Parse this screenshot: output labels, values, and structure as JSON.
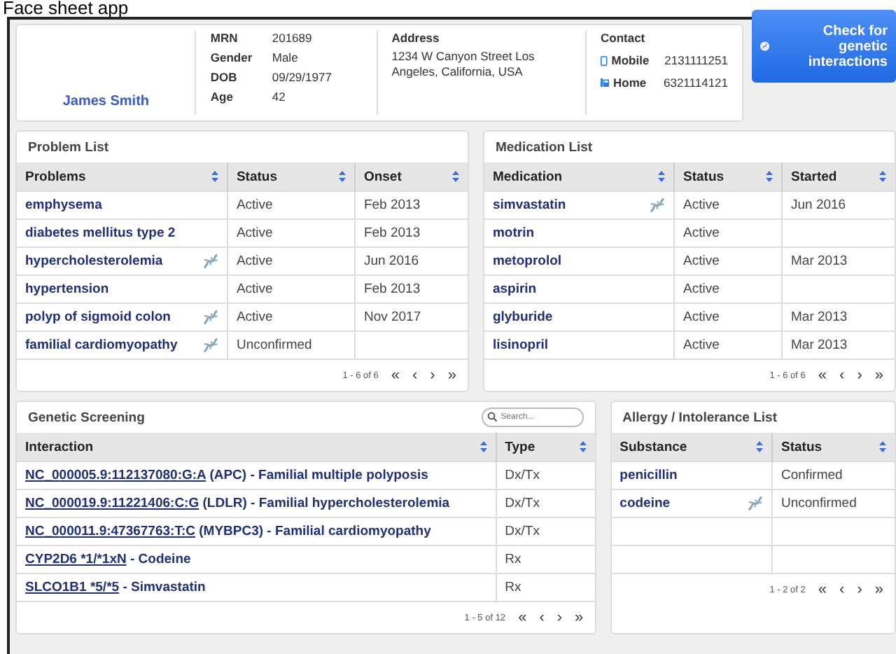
{
  "app_title": "Face sheet app",
  "patient": {
    "name": "James Smith",
    "fields": [
      {
        "label": "MRN",
        "value": "201689"
      },
      {
        "label": "Gender",
        "value": "Male"
      },
      {
        "label": "DOB",
        "value": "09/29/1977"
      },
      {
        "label": "Age",
        "value": "42"
      }
    ],
    "address": {
      "label": "Address",
      "value": "1234 W Canyon Street Los Angeles, California, USA"
    },
    "contact": {
      "label": "Contact",
      "phones": [
        {
          "kind": "mobile",
          "label": "Mobile",
          "value": "2131111251"
        },
        {
          "kind": "home",
          "label": "Home",
          "value": "6321114121"
        }
      ]
    }
  },
  "check_button": {
    "label": "Check for genetic interactions"
  },
  "problem_list": {
    "title": "Problem List",
    "columns": [
      "Problems",
      "Status",
      "Onset"
    ],
    "rows": [
      {
        "cells": [
          "emphysema",
          "Active",
          "Feb 2013"
        ],
        "genetic": false
      },
      {
        "cells": [
          "diabetes mellitus type 2",
          "Active",
          "Feb 2013"
        ],
        "genetic": false
      },
      {
        "cells": [
          "hypercholesterolemia",
          "Active",
          "Jun 2016"
        ],
        "genetic": true
      },
      {
        "cells": [
          "hypertension",
          "Active",
          "Feb 2013"
        ],
        "genetic": false
      },
      {
        "cells": [
          "polyp of sigmoid colon",
          "Active",
          "Nov 2017"
        ],
        "genetic": true
      },
      {
        "cells": [
          "familial cardiomyopathy",
          "Unconfirmed",
          ""
        ],
        "genetic": true
      }
    ],
    "pager": {
      "range": "1 - 6 of 6",
      "controls": [
        "«",
        "‹",
        "›",
        "»"
      ]
    }
  },
  "medication_list": {
    "title": "Medication List",
    "columns": [
      "Medication",
      "Status",
      "Started"
    ],
    "rows": [
      {
        "cells": [
          "simvastatin",
          "Active",
          "Jun 2016"
        ],
        "genetic": true
      },
      {
        "cells": [
          "motrin",
          "Active",
          ""
        ],
        "genetic": false
      },
      {
        "cells": [
          "metoprolol",
          "Active",
          "Mar 2013"
        ],
        "genetic": false
      },
      {
        "cells": [
          "aspirin",
          "Active",
          ""
        ],
        "genetic": false
      },
      {
        "cells": [
          "glyburide",
          "Active",
          "Mar 2013"
        ],
        "genetic": false
      },
      {
        "cells": [
          "lisinopril",
          "Active",
          "Mar 2013"
        ],
        "genetic": false
      }
    ],
    "pager": {
      "range": "1 - 6 of 6",
      "controls": [
        "«",
        "‹",
        "›",
        "»"
      ]
    }
  },
  "genetic_screening": {
    "title": "Genetic Screening",
    "search": {
      "placeholder": "Search..."
    },
    "columns": [
      "Interaction",
      "Type"
    ],
    "rows": [
      {
        "variant": "NC_000005.9:112137080:G:A",
        "description": "(APC) - Familial multiple polyposis",
        "type": "Dx/Tx"
      },
      {
        "variant": "NC_000019.9:11221406:C:G",
        "description": "(LDLR) - Familial hypercholesterolemia",
        "type": "Dx/Tx"
      },
      {
        "variant": "NC_000011.9:47367763:T:C",
        "description": "(MYBPC3) - Familial cardiomyopathy",
        "type": "Dx/Tx"
      },
      {
        "variant": "CYP2D6 *1/*1xN",
        "description": "- Codeine",
        "type": "Rx"
      },
      {
        "variant": "SLCO1B1 *5/*5",
        "description": "- Simvastatin",
        "type": "Rx"
      }
    ],
    "pager": {
      "range": "1 - 5 of 12",
      "controls": [
        "«",
        "‹",
        "›",
        "»"
      ]
    }
  },
  "allergy_list": {
    "title": "Allergy / Intolerance List",
    "columns": [
      "Substance",
      "Status"
    ],
    "rows": [
      {
        "cells": [
          "penicillin",
          "Confirmed"
        ],
        "genetic": false
      },
      {
        "cells": [
          "codeine",
          "Unconfirmed"
        ],
        "genetic": true
      }
    ],
    "pager": {
      "range": "1 - 2 of 2",
      "controls": [
        "«",
        "‹",
        "›",
        "»"
      ]
    }
  }
}
